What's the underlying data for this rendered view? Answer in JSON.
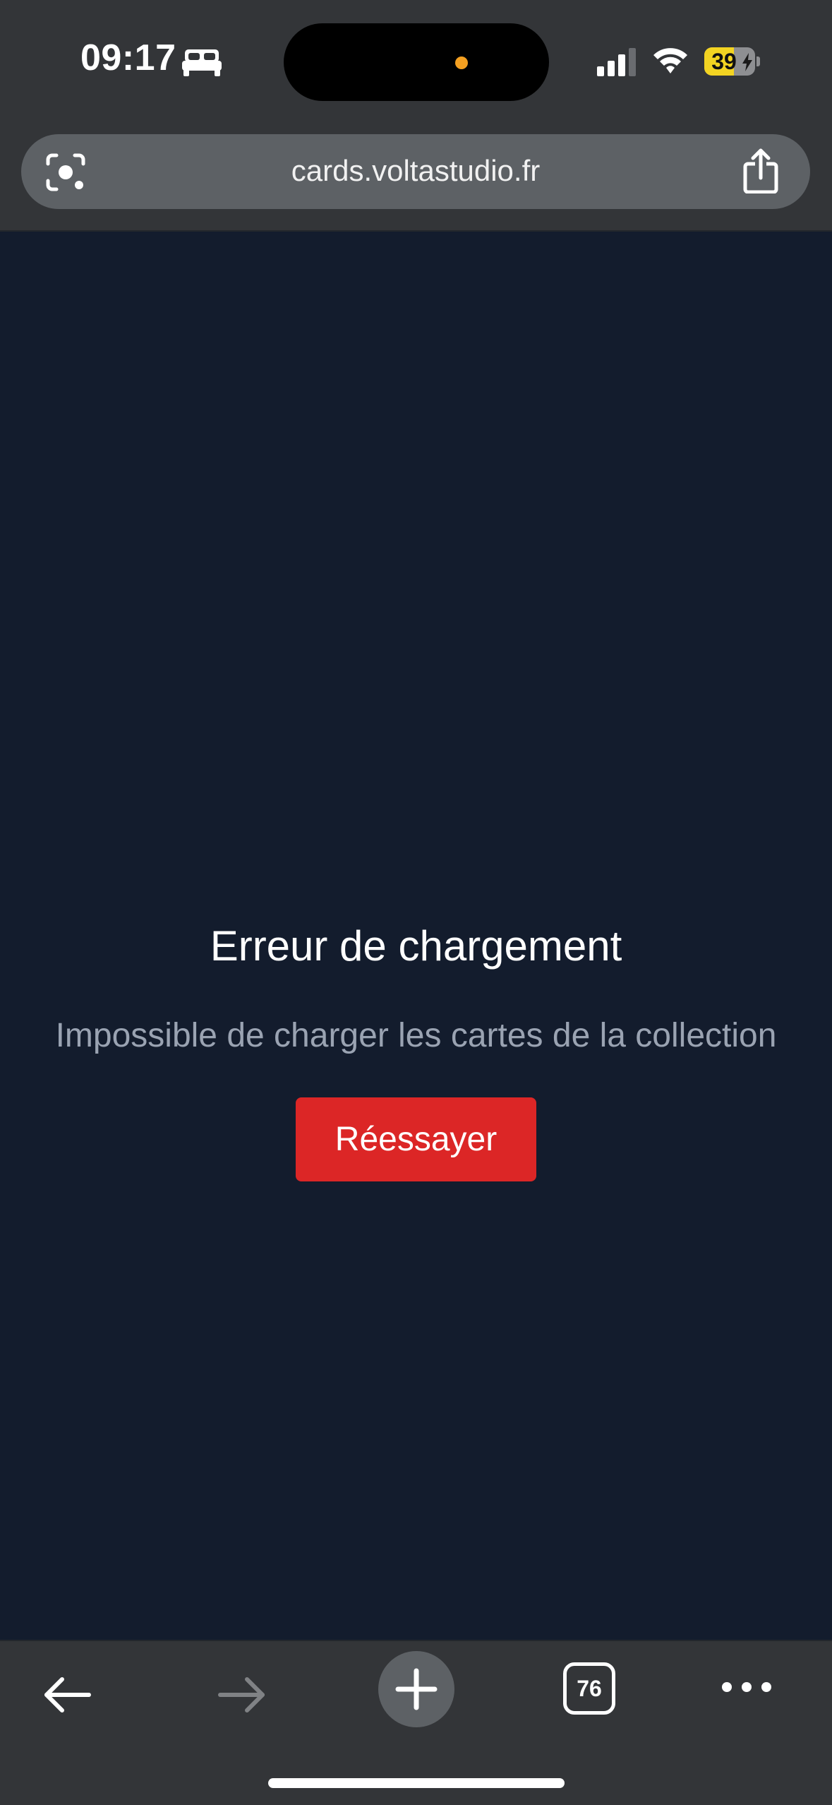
{
  "status_bar": {
    "time": "09:17",
    "battery_level": "39",
    "battery_charging": true,
    "sleep_focus_icon": "bed-icon",
    "island_dot_color": "#f4a021"
  },
  "browser": {
    "url": "cards.voltastudio.fr",
    "tab_count": "76",
    "lens_icon": "camera-lens-icon",
    "share_icon": "share-icon"
  },
  "page": {
    "error_title": "Erreur de chargement",
    "error_message": "Impossible de charger les cartes de la collection",
    "retry_label": "Réessayer",
    "background_color": "#131c2d",
    "accent_color": "#dc2626"
  },
  "toolbar": {
    "back_icon": "arrow-left-icon",
    "forward_icon": "arrow-right-icon",
    "new_tab_icon": "plus-icon",
    "tabs_icon": "tabs-icon",
    "menu_icon": "more-dots-icon"
  }
}
